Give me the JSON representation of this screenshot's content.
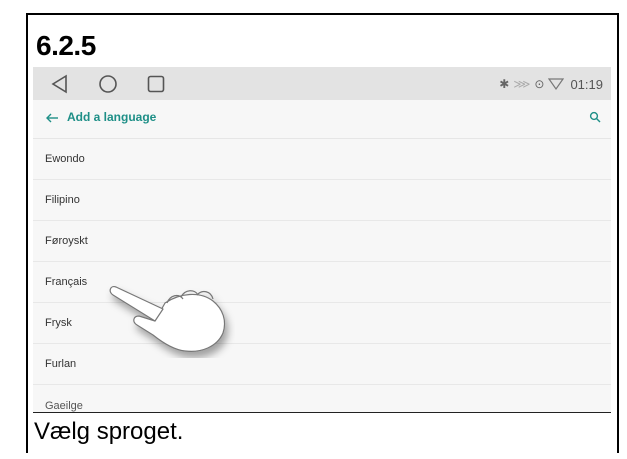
{
  "step": "6.2.5",
  "statusbar": {
    "time": "01:19",
    "icons": [
      "bluetooth-icon",
      "vibrate-icon",
      "location-icon",
      "wifi-icon"
    ]
  },
  "appbar": {
    "title": "Add a language",
    "back_icon": "arrow-back-icon",
    "search_icon": "search-icon",
    "accent_color": "#1e8f87"
  },
  "languages": [
    "Ewondo",
    "Filipino",
    "Føroyskt",
    "Français",
    "Frysk",
    "Furlan",
    "Gaeilge"
  ],
  "caption": "Vælg sproget."
}
